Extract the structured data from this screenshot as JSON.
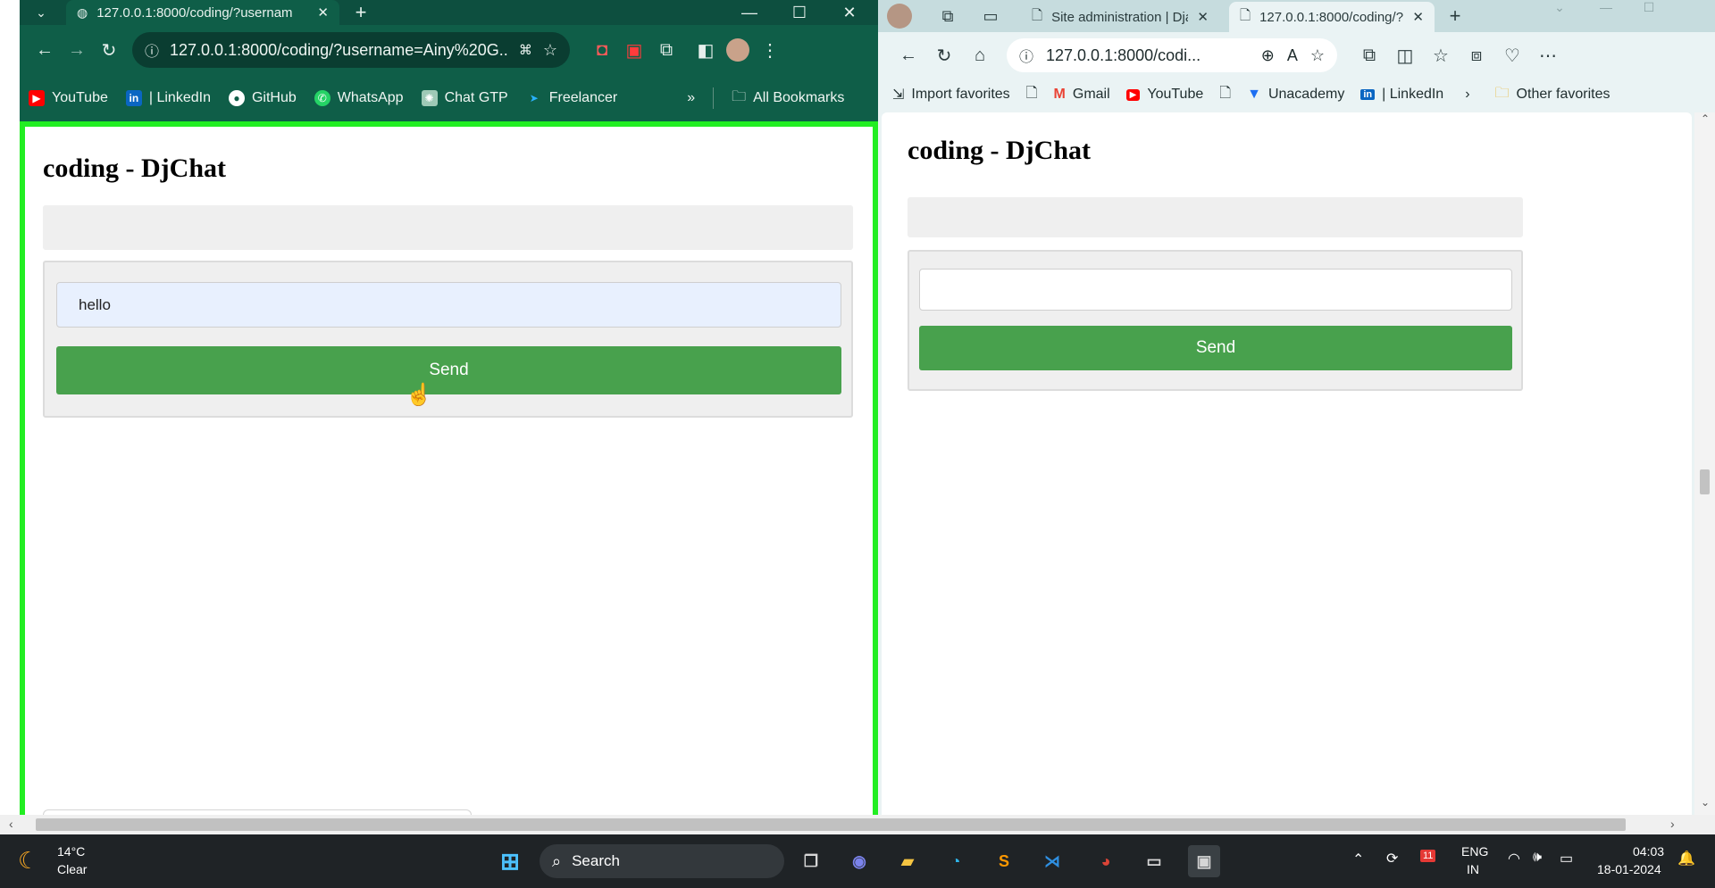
{
  "left_browser": {
    "tab_title": "127.0.0.1:8000/coding/?usernam",
    "url": "127.0.0.1:8000/coding/?username=Ainy%20G...",
    "bookmarks": [
      {
        "label": "YouTube",
        "icon": "youtube-icon",
        "color": "#ff0000"
      },
      {
        "label": "| LinkedIn",
        "icon": "linkedin-icon",
        "color": "#0a66c2"
      },
      {
        "label": "GitHub",
        "icon": "github-icon",
        "color": "#ffffff"
      },
      {
        "label": "WhatsApp",
        "icon": "whatsapp-icon",
        "color": "#25d366"
      },
      {
        "label": "Chat GTP",
        "icon": "chatgpt-icon",
        "color": "#9ec9b6"
      },
      {
        "label": "Freelancer",
        "icon": "freelancer-icon",
        "color": "#29b2fe"
      }
    ],
    "all_bookmarks": "All Bookmarks",
    "page": {
      "title": "coding - DjChat",
      "message_input_value": "hello",
      "send_label": "Send"
    }
  },
  "right_browser": {
    "tabs": [
      {
        "title": "Site administration | Dja"
      },
      {
        "title": "127.0.0.1:8000/coding/?"
      }
    ],
    "url": "127.0.0.1:8000/codi...",
    "bookmarks": [
      {
        "label": "Import favorites",
        "icon": "import-icon"
      },
      {
        "label": "",
        "icon": "page-icon"
      },
      {
        "label": "Gmail",
        "icon": "gmail-icon"
      },
      {
        "label": "YouTube",
        "icon": "youtube-icon"
      },
      {
        "label": "",
        "icon": "page-icon"
      },
      {
        "label": "Unacademy",
        "icon": "unacademy-icon"
      },
      {
        "label": "| LinkedIn",
        "icon": "linkedin-icon"
      }
    ],
    "other_favorites": "Other favorites",
    "page": {
      "title": "coding - DjChat",
      "message_input_value": "",
      "send_label": "Send"
    }
  },
  "taskbar": {
    "weather_temp": "14°C",
    "weather_desc": "Clear",
    "search_label": "Search",
    "language": "ENG",
    "region": "IN",
    "time": "04:03",
    "date": "18-01-2024",
    "notification_badge": "11"
  },
  "colors": {
    "chrome_theme": "#0f5e48",
    "focus_border": "#22ee22",
    "send_button": "#48a14d",
    "edge_theme": "#eaf3f4"
  }
}
